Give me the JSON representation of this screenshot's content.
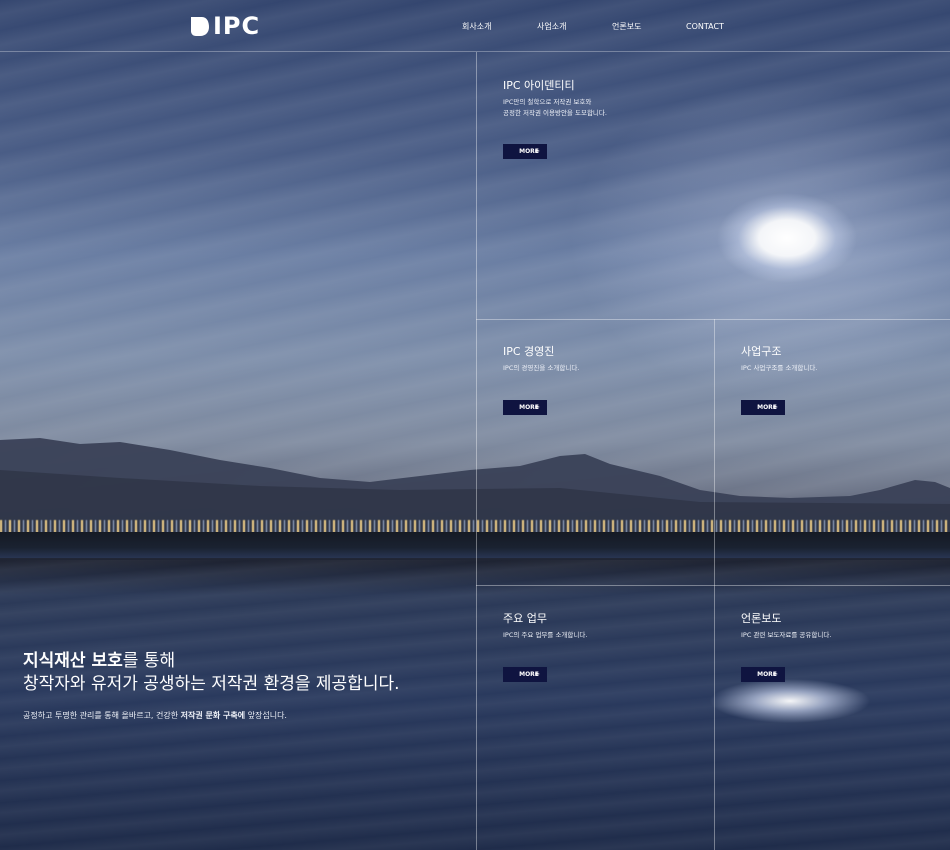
{
  "header": {
    "logo_text": "IPC",
    "nav": [
      {
        "label": "회사소개"
      },
      {
        "label": "사업소개"
      },
      {
        "label": "언론보도"
      },
      {
        "label": "CONTACT"
      }
    ]
  },
  "cards": [
    {
      "title": "IPC 아이덴티티",
      "desc_lines": [
        "IPC만의 철학으로 저작권 보호와",
        "공정한 저작권 이용방안을 도모합니다."
      ],
      "button": "MORE"
    },
    {
      "title": "IPC 경영진",
      "desc_lines": [
        "IPC의 경영진을 소개합니다."
      ],
      "button": "MORE"
    },
    {
      "title": "사업구조",
      "desc_lines": [
        "IPC 사업구조를 소개합니다."
      ],
      "button": "MORE"
    },
    {
      "title": "주요 업무",
      "desc_lines": [
        "IPC의 주요 업무를 소개합니다."
      ],
      "button": "MORE"
    },
    {
      "title": "언론보도",
      "desc_lines": [
        "IPC 관련 보도자료를 공유합니다."
      ],
      "button": "MORE"
    }
  ],
  "hero": {
    "line1_bold": "지식재산 보호",
    "line1_rest": "를 통해",
    "line2": "창작자와 유저가 공생하는 저작권 환경을 제공합니다.",
    "sub_prefix": "공정하고 투명한 관리를 통해 올바르고, 건강한 ",
    "sub_bold": "저작권 문화 구축에",
    "sub_suffix": " 앞장섭니다."
  },
  "button_plus": "+",
  "colors": {
    "button_bg": "#0f1440",
    "grid_line": "rgba(255,255,255,0.38)"
  }
}
